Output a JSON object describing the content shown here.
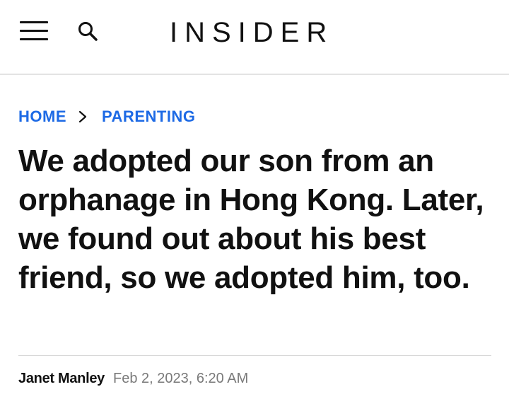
{
  "header": {
    "menu_icon": "hamburger-menu-icon",
    "search_icon": "search-icon",
    "logo": "INSIDER"
  },
  "breadcrumb": {
    "home": "HOME",
    "section": "PARENTING",
    "separator_icon": "chevron-right-icon",
    "link_color": "#1d6ae5"
  },
  "article": {
    "headline": "We adopted our son from an orphanage in Hong Kong. Later, we found out about his best friend, so we adopted him, too.",
    "author": "Janet Manley",
    "date": "Feb 2, 2023, 6:20 AM"
  }
}
